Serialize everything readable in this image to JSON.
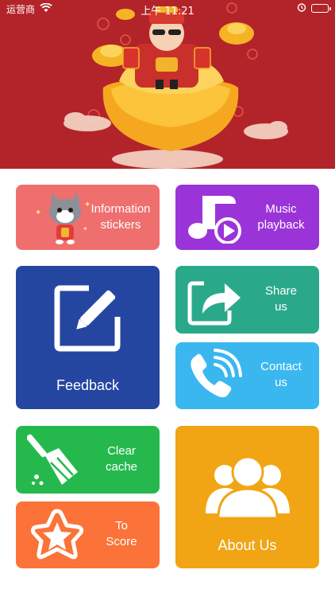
{
  "status_bar": {
    "carrier": "运营商",
    "time": "上午 11:21"
  },
  "tiles": {
    "info": {
      "line1": "Information",
      "line2": "stickers",
      "icon": "cat-sticker-icon"
    },
    "music": {
      "line1": "Music",
      "line2": "playback",
      "icon": "music-note-play-icon"
    },
    "feedback": {
      "label": "Feedback",
      "icon": "edit-pencil-icon"
    },
    "share": {
      "line1": "Share",
      "line2": "us",
      "icon": "share-arrow-icon"
    },
    "contact": {
      "line1": "Contact",
      "line2": "us",
      "icon": "phone-icon"
    },
    "cache": {
      "line1": "Clear",
      "line2": "cache",
      "icon": "broom-icon"
    },
    "score": {
      "line1": "To",
      "line2": "Score",
      "icon": "star-icon"
    },
    "about": {
      "label": "About Us",
      "icon": "group-users-icon"
    }
  },
  "colors": {
    "banner": "#b3242a",
    "info": "#ef6f6f",
    "music": "#9b34d8",
    "feedback": "#2546a0",
    "share": "#2aa98a",
    "contact": "#3ab7ef",
    "cache": "#25b94d",
    "score": "#fb7338",
    "about": "#f1a514"
  }
}
